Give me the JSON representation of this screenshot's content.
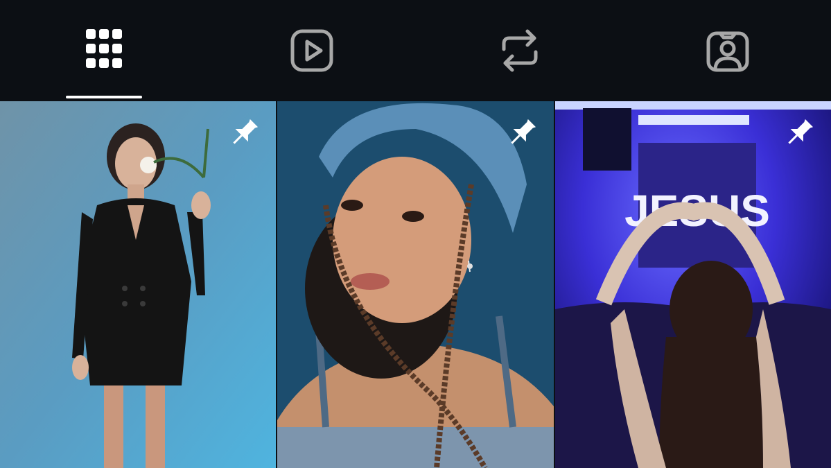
{
  "tabs": [
    {
      "name": "grid",
      "icon": "grid-icon",
      "active": true
    },
    {
      "name": "reels",
      "icon": "reels-play-icon",
      "active": false
    },
    {
      "name": "reposts",
      "icon": "repost-icon",
      "active": false
    },
    {
      "name": "tagged",
      "icon": "tagged-person-icon",
      "active": false
    }
  ],
  "posts": [
    {
      "pinned": true,
      "icon": "pin-icon",
      "description_icon": "photo"
    },
    {
      "pinned": true,
      "icon": "pin-icon",
      "description_icon": "photo"
    },
    {
      "pinned": true,
      "icon": "pin-icon",
      "description_icon": "photo",
      "overlay_text": "JESUS"
    }
  ],
  "colors": {
    "background": "#0c0f14",
    "active_icon": "#ffffff",
    "inactive_icon": "#a8a8a8",
    "indicator": "#ffffff"
  }
}
